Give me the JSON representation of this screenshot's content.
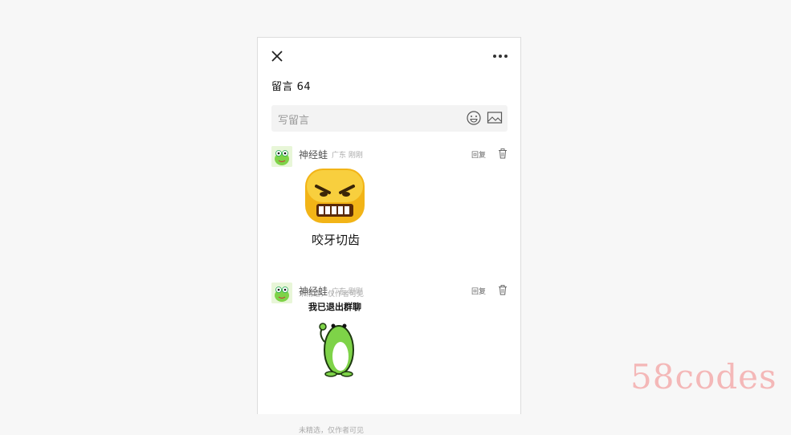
{
  "header": {
    "title": "留言 64"
  },
  "compose": {
    "placeholder": "写留言"
  },
  "comments": [
    {
      "name": "神经蛙",
      "region": "广东",
      "time": "刚刚",
      "reply_label": "回复",
      "sticker_caption": "咬牙切齿",
      "note": "未精选，仅作者可见"
    },
    {
      "name": "神经蛙",
      "region": "广东",
      "time": "刚刚",
      "reply_label": "回复",
      "sticker_caption": "我已退出群聊",
      "note": "未精选，仅作者可见"
    }
  ],
  "watermark": "58codes",
  "colors": {
    "page_bg": "#f7f7f7",
    "panel_bg": "#ffffff",
    "input_bg": "#f3f3f3",
    "frog_green": "#7ed348",
    "watermark": "#f4b8b8"
  }
}
